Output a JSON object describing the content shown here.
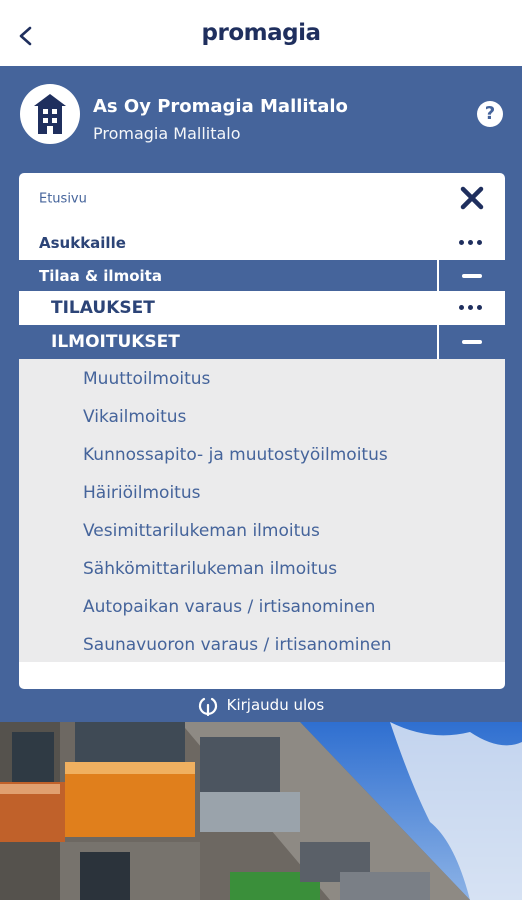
{
  "app": {
    "brand": "promagia"
  },
  "header": {
    "org_name": "As Oy Promagia Mallitalo",
    "org_sub": "Promagia Mallitalo",
    "help_label": "?"
  },
  "menu": {
    "etusivu": "Etusivu",
    "asukkaille": "Asukkaille",
    "tilaa_ilmoita": "Tilaa & ilmoita",
    "tilaukset": "TILAUKSET",
    "ilmoitukset": "ILMOITUKSET",
    "items": [
      {
        "label": "Muuttoilmoitus"
      },
      {
        "label": "Vikailmoitus"
      },
      {
        "label": "Kunnossapito- ja muutostyöilmoitus"
      },
      {
        "label": "Häiriöilmoitus"
      },
      {
        "label": "Vesimittarilukeman ilmoitus"
      },
      {
        "label": "Sähkömittarilukeman ilmoitus"
      },
      {
        "label": "Autopaikan varaus / irtisanominen"
      },
      {
        "label": "Saunavuoron varaus / irtisanominen"
      }
    ]
  },
  "footer": {
    "logout": "Kirjaudu ulos"
  },
  "colors": {
    "primary": "#45649b",
    "dark": "#1f2f5e",
    "submenu_bg": "#ebebec"
  }
}
